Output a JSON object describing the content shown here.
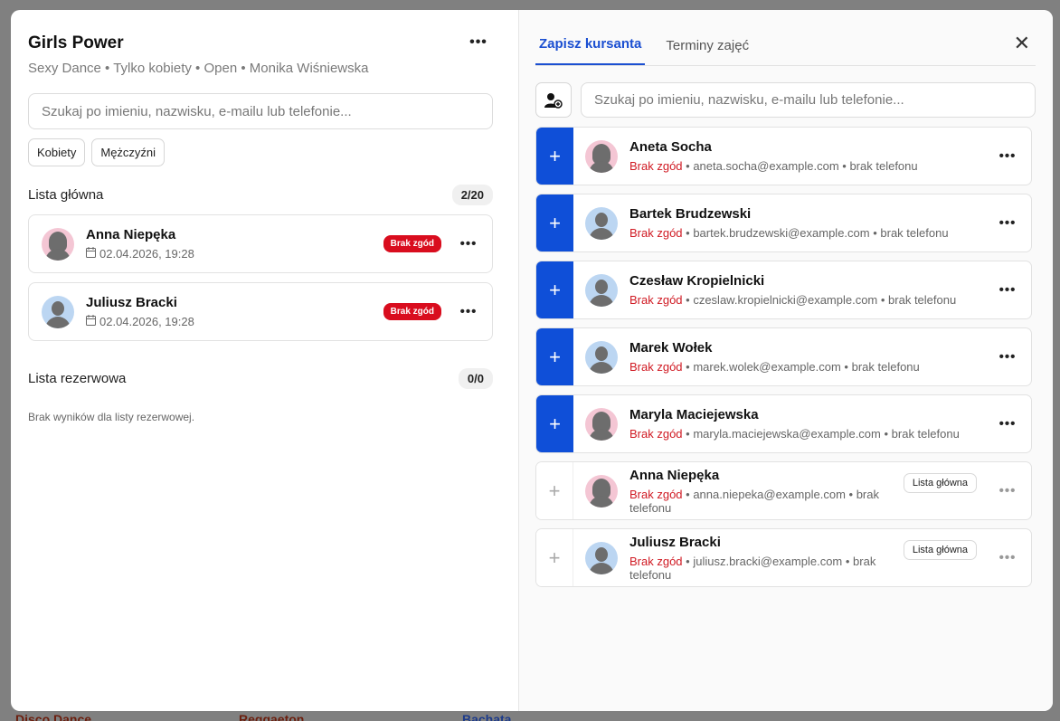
{
  "background": {
    "bottom_items": [
      "Disco Dance",
      "Reggaeton",
      "Bachata"
    ]
  },
  "left": {
    "title": "Girls Power",
    "subtitle": "Sexy Dance • Tylko kobiety • Open • Monika Wiśniewska",
    "more_label": "•••",
    "search_placeholder": "Szukaj po imieniu, nazwisku, e-mailu lub telefonie...",
    "filters": [
      "Kobiety",
      "Mężczyźni"
    ],
    "main_list": {
      "title": "Lista główna",
      "count": "2/20",
      "items": [
        {
          "name": "Anna Niepęka",
          "date": "02.04.2026, 19:28",
          "badge": "Brak zgód",
          "avatar": "female"
        },
        {
          "name": "Juliusz Bracki",
          "date": "02.04.2026, 19:28",
          "badge": "Brak zgód",
          "avatar": "male"
        }
      ]
    },
    "reserve_list": {
      "title": "Lista rezerwowa",
      "count": "0/0",
      "empty": "Brak wyników dla listy rezerwowej."
    }
  },
  "right": {
    "tabs": [
      "Zapisz kursanta",
      "Terminy zajęć"
    ],
    "close_label": "✕",
    "search_placeholder": "Szukaj po imieniu, nazwisku, e-mailu lub telefonie...",
    "candidates": [
      {
        "name": "Aneta Socha",
        "warn": "Brak zgód",
        "email": "aneta.socha@example.com",
        "phone": "brak telefonu",
        "enrolled": false,
        "avatar": "female"
      },
      {
        "name": "Bartek Brudzewski",
        "warn": "Brak zgód",
        "email": "bartek.brudzewski@example.com",
        "phone": "brak telefonu",
        "enrolled": false,
        "avatar": "male"
      },
      {
        "name": "Czesław Kropielnicki",
        "warn": "Brak zgód",
        "email": "czeslaw.kropielnicki@example.com",
        "phone": "brak telefonu",
        "enrolled": false,
        "avatar": "male"
      },
      {
        "name": "Marek Wołek",
        "warn": "Brak zgód",
        "email": "marek.wolek@example.com",
        "phone": "brak telefonu",
        "enrolled": false,
        "avatar": "male"
      },
      {
        "name": "Maryla Maciejewska",
        "warn": "Brak zgód",
        "email": "maryla.maciejewska@example.com",
        "phone": "brak telefonu",
        "enrolled": false,
        "avatar": "female"
      },
      {
        "name": "Anna Niepęka",
        "warn": "Brak zgód",
        "email": "anna.niepeka@example.com",
        "phone": "brak telefonu",
        "enrolled": true,
        "status": "Lista główna",
        "avatar": "female"
      },
      {
        "name": "Juliusz Bracki",
        "warn": "Brak zgód",
        "email": "juliusz.bracki@example.com",
        "phone": "brak telefonu",
        "enrolled": true,
        "status": "Lista główna",
        "avatar": "male"
      }
    ]
  },
  "colors": {
    "accent": "#0f4fd8",
    "danger": "#d90d1e",
    "female_avatar_bg": "#f4c6d4",
    "male_avatar_bg": "#bcd6f2"
  }
}
